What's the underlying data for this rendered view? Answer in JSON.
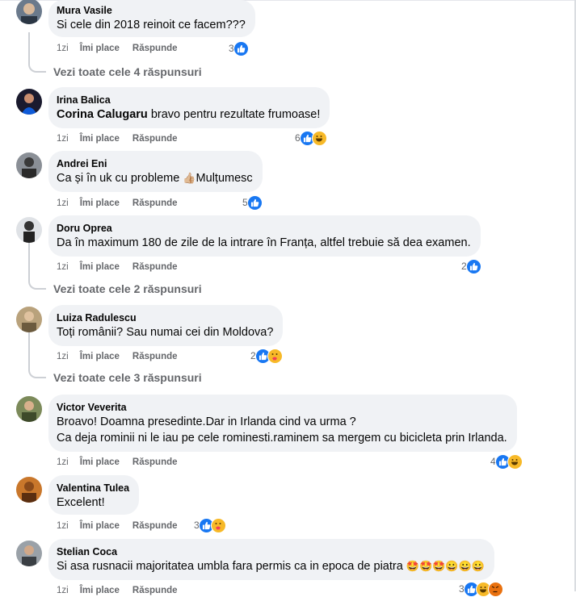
{
  "action_labels": {
    "time": "1zi",
    "like": "Îmi place",
    "reply": "Răspunde"
  },
  "comments": [
    {
      "author": "Mura Vasile",
      "text": "Si cele din 2018 reinoit ce facem???",
      "reactions": "3",
      "reaction_types": [
        "like"
      ],
      "replies": "Vezi toate cele 4 răspunsuri"
    },
    {
      "author": "Irina Balica",
      "mention": "Corina Calugaru",
      "text": " bravo pentru rezultate frumoase!",
      "reactions": "6",
      "reaction_types": [
        "like",
        "haha"
      ]
    },
    {
      "author": "Andrei Eni",
      "text_before": "Ca și în uk cu probleme ",
      "emoji": "👍🏼",
      "text_after": "Mulțumesc",
      "reactions": "5",
      "reaction_types": [
        "like"
      ]
    },
    {
      "author": "Doru Oprea",
      "text": "Da în maximum 180 de zile de la intrare în Franța, altfel trebuie să dea examen.",
      "reactions": "2",
      "reaction_types": [
        "like"
      ],
      "replies": "Vezi toate cele 2 răspunsuri"
    },
    {
      "author": "Luiza Radulescu",
      "text": "Toți românii? Sau numai cei din Moldova?",
      "reactions": "2",
      "reaction_types": [
        "like",
        "care"
      ],
      "replies": "Vezi toate cele 3 răspunsuri"
    },
    {
      "author": "Victor Veverita",
      "text_line1": "Broavo! Doamna presedinte.Dar in Irlanda cind va urma ?",
      "text_line2": "Ca deja rominii ni le iau pe cele rominesti.raminem sa mergem cu bicicleta prin Irlanda.",
      "reactions": "4",
      "reaction_types": [
        "like",
        "haha"
      ]
    },
    {
      "author": "Valentina Tulea",
      "text": "Excelent!",
      "reactions": "3",
      "reaction_types": [
        "like",
        "care"
      ]
    },
    {
      "author": "Stelian Coca",
      "text": "Si asa rusnacii majoritatea umbla fara permis ca in epoca de piatra ",
      "emoji": "🤩🤩🤩😀😀😀",
      "reactions": "3",
      "reaction_types": [
        "like",
        "haha",
        "angry"
      ]
    }
  ],
  "colors": {
    "like": "#1877f2",
    "haha": "#f7b928",
    "angry": "#e9710f",
    "secondary_text": "#65676b",
    "bubble": "#f0f2f5"
  }
}
